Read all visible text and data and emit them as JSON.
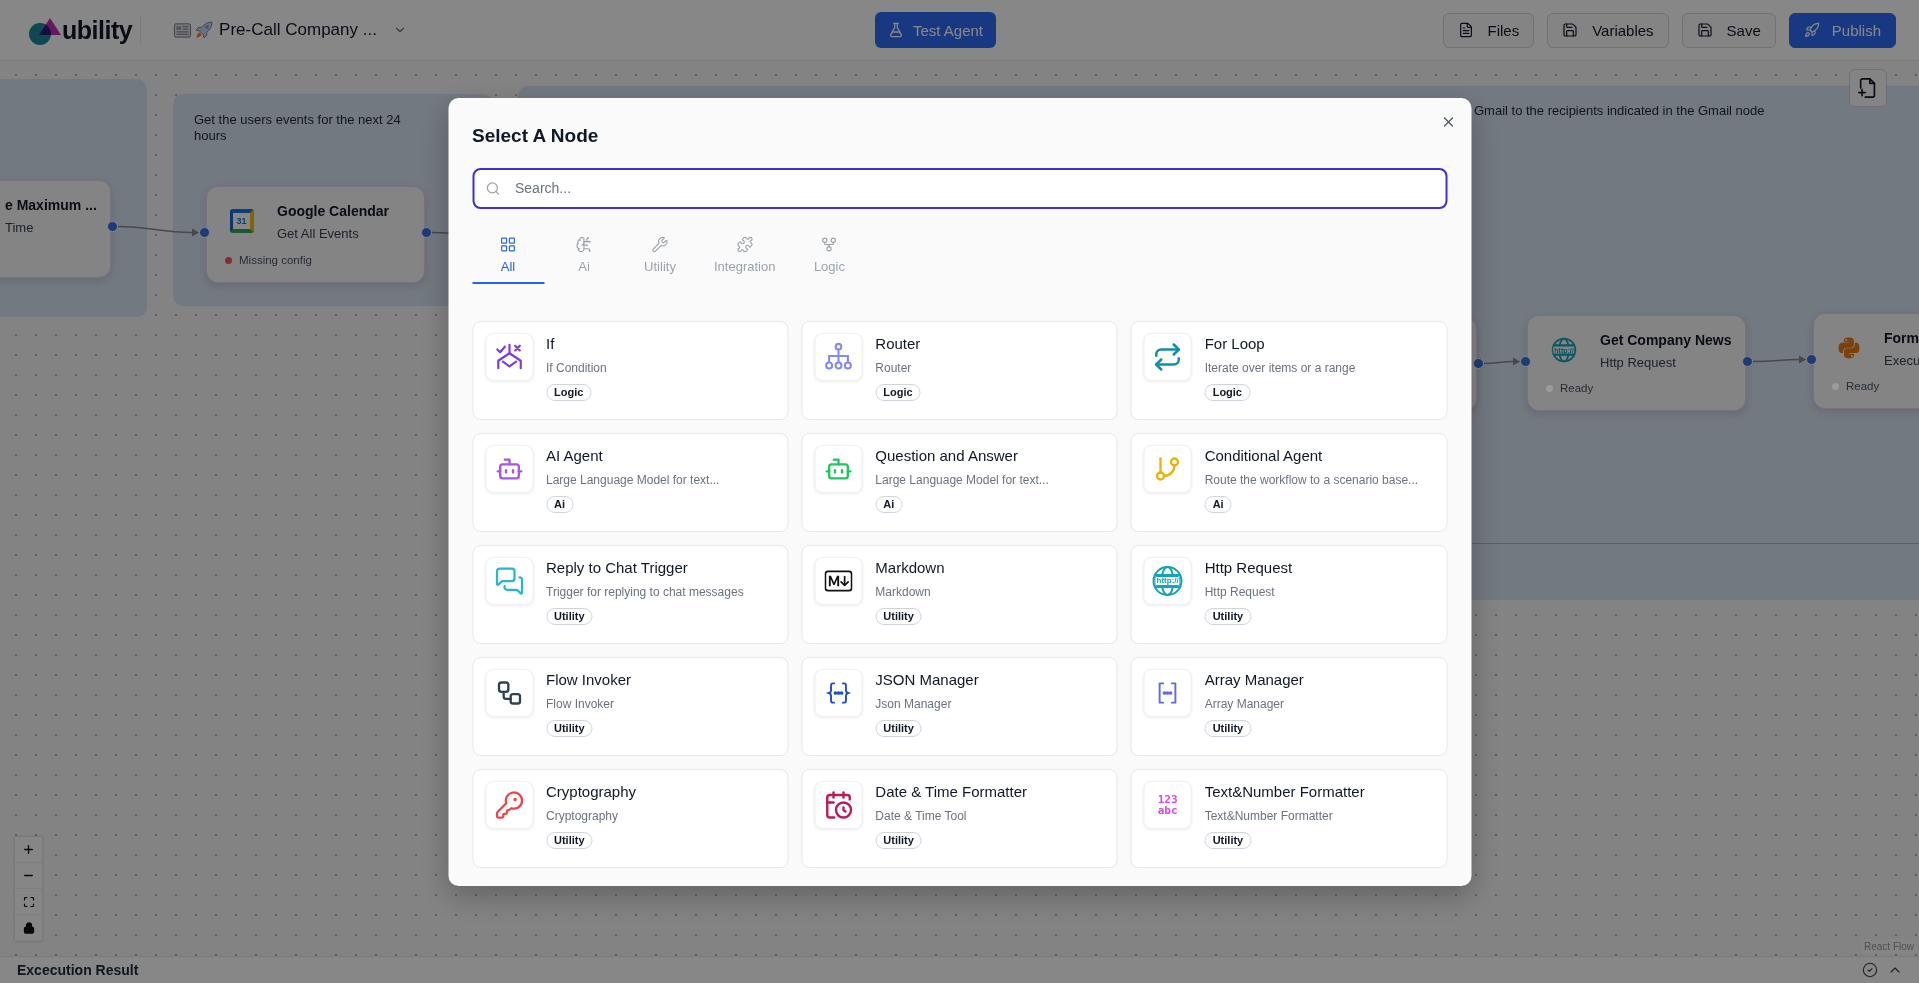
{
  "top_bar": {
    "logo": "ubility",
    "workflow_title": "Pre-Call Company ...",
    "test_button": "Test Agent",
    "actions": [
      {
        "label": "Files",
        "kind": "outline"
      },
      {
        "label": "Variables",
        "kind": "outline"
      },
      {
        "label": "Save",
        "kind": "outline"
      },
      {
        "label": "Publish",
        "kind": "primary"
      }
    ]
  },
  "canvas": {
    "groups": [
      {
        "description": "Get the users events for the next 24 hours"
      },
      {
        "description": "Gmail to the recipients indicated in the Gmail node"
      }
    ],
    "nodes": [
      {
        "title": "e Maximum ...",
        "subtitle": "Time"
      },
      {
        "title": "Google Calendar",
        "subtitle": "Get All Events",
        "icon_text": "31",
        "status": "Missing config",
        "color": "#8b2a2a"
      },
      {
        "title": "Get Company News",
        "subtitle": "Http Request",
        "icon_text": "http://",
        "status": "Ready",
        "color": "#9b9b9b"
      },
      {
        "title": "Form",
        "subtitle": "Execu",
        "status": "Ready",
        "color": "#9b9b9b"
      }
    ],
    "attribution": "React Flow"
  },
  "modal": {
    "title": "Select A Node",
    "search": {
      "placeholder": "Search..."
    },
    "tabs": [
      {
        "label": "All",
        "selected": true
      },
      {
        "label": "Ai",
        "selected": false
      },
      {
        "label": "Utility",
        "selected": false
      },
      {
        "label": "Integration",
        "selected": false
      },
      {
        "label": "Logic",
        "selected": false
      }
    ],
    "cards": [
      {
        "title": "If",
        "description": "If Condition",
        "tag": "Logic"
      },
      {
        "title": "Router",
        "description": "Router",
        "tag": "Logic"
      },
      {
        "title": "For Loop",
        "description": "Iterate over items or a range",
        "tag": "Logic"
      },
      {
        "title": "AI Agent",
        "description": "Large Language Model for text...",
        "tag": "Ai"
      },
      {
        "title": "Question and Answer",
        "description": "Large Language Model for text...",
        "tag": "Ai"
      },
      {
        "title": "Conditional Agent",
        "description": "Route the workflow to a scenario base...",
        "tag": "Ai"
      },
      {
        "title": "Reply to Chat Trigger",
        "description": "Trigger for replying to chat messages",
        "tag": "Utility"
      },
      {
        "title": "Markdown",
        "description": "Markdown",
        "tag": "Utility"
      },
      {
        "title": "Http Request",
        "description": "Http Request",
        "tag": "Utility",
        "icon_text": "http://"
      },
      {
        "title": "Flow Invoker",
        "description": "Flow Invoker",
        "tag": "Utility"
      },
      {
        "title": "JSON Manager",
        "description": "Json Manager",
        "tag": "Utility"
      },
      {
        "title": "Array Manager",
        "description": "Array Manager",
        "tag": "Utility"
      },
      {
        "title": "Cryptography",
        "description": "Cryptography",
        "tag": "Utility"
      },
      {
        "title": "Date & Time Formatter",
        "description": "Date & Time Tool",
        "tag": "Utility"
      },
      {
        "title": "Text&Number Formatter",
        "description": "Text&Number Formatter",
        "tag": "Utility",
        "icon_lines": [
          "123",
          "abc"
        ]
      }
    ]
  },
  "bottom_panel": {
    "title": "Excecution Result"
  }
}
